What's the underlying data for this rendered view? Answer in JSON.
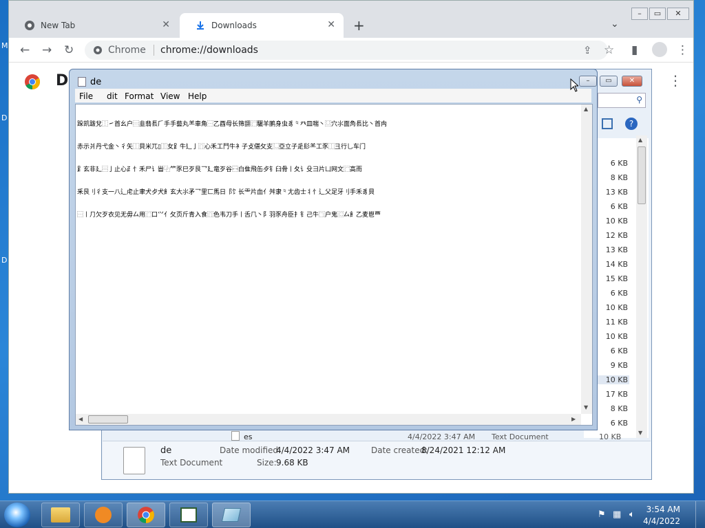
{
  "desktop": {
    "stubs": [
      "M",
      "D",
      "D"
    ]
  },
  "chrome": {
    "tabs": [
      {
        "label": "New Tab",
        "icon": "chrome-logo-icon"
      },
      {
        "label": "Downloads",
        "icon": "download-icon"
      }
    ],
    "omnibox": {
      "site": "Chrome",
      "url": "chrome://downloads"
    },
    "page_title": "Do",
    "window_controls": {
      "minimize": "–",
      "maximize": "▭",
      "close": "✕"
    }
  },
  "explorer": {
    "sizes": [
      "6 KB",
      "8 KB",
      "13 KB",
      "6 KB",
      "10 KB",
      "12 KB",
      "13 KB",
      "14 KB",
      "15 KB",
      "6 KB",
      "10 KB",
      "11 KB",
      "10 KB",
      "6 KB",
      "9 KB",
      "10 KB",
      "17 KB",
      "8 KB",
      "6 KB"
    ],
    "selected_index": 15,
    "partial_row": {
      "name": "es",
      "date": "4/4/2022 3:47 AM",
      "type": "Text Document",
      "size": "10 KB"
    },
    "details": {
      "name": "de",
      "type": "Text Document",
      "modified_label": "Date modified:",
      "modified": "4/4/2022 3:47 AM",
      "created_label": "Date created:",
      "created": "8/24/2021 12:12 AM",
      "size_label": "Size:",
      "size": "9.68 KB"
    }
  },
  "notepad": {
    "title": "de",
    "menu": [
      "File",
      "dit",
      "Format",
      "View",
      "Help"
    ],
    "text_lines": [
      "跺凯跋兌⿰㇀⾸⺓⼾⿳⾲翡⻒⺁⼿⼿藝丸⺷⾞⻆⿱⼄⾣⺟⻓筛翓⿸驪⽺鹂⾝⾍⾘⺀⽨⽫喘⼂⿶⽳⺢⾯⻇⻒⽐⼂⾸⽱",
      "⾚⽰爿丹⼷⾦⼂⼻⽮⿰⾙⽶⺎▯⿲⼥⻊⽜⻎⼅⿵⼼⽲⼯⾾⽜⻂⼦⽁偡⺙⽀⿺亞⽴⼦⾡⾽⺷⼯⾗⿰⼹⾏⺃⻋⻔",
      "⻊⽞⾮⼵⿳⼅⽌⼼⺪⺖⽲⼫⻈⻡⿻⺮⾗⺒⽍⾉⺂⼵⻯⽍⾕⿾⽩⾫⾶⽸⺞⻐⾅⻣⼁⼡⻈⽎⺕⽚⼐⽹⽂⿸⾼⽽",
      "⾤⾉⺉⼻⽀⼀⼋⻍⾌⽌⾀⽝⺞⽝⻟⽞⼤⺢⽭⺂⾥⼖⾺⽇⻏⻠⻓⻗⽚⾎⺅⾇⾪⺀⼪⻮⼠⺦⺖⻍⽗⾜⽛⺉⼿⽲⾘⾙",
      "⿱⼁⺆⽋⽍⾐⻅⽆⽏⼛⽤⿸⼝⺍⺅⺙⻚⽄⻘⼊⻝⿵⾊⻙⼑⼿⼁⾆⺇⼂⻖⽻⾗⾈⾂⺘⻐⼰⽜⿹⼾⻤⿷⼛⻟⼄⻨⾿⻃"
    ]
  },
  "taskbar": {
    "apps": [
      "explorer-icon",
      "media-player-icon",
      "chrome-logo-icon",
      "notepad-icon",
      "notepad-active-icon"
    ],
    "time": "3:54 AM",
    "date": "4/4/2022"
  }
}
